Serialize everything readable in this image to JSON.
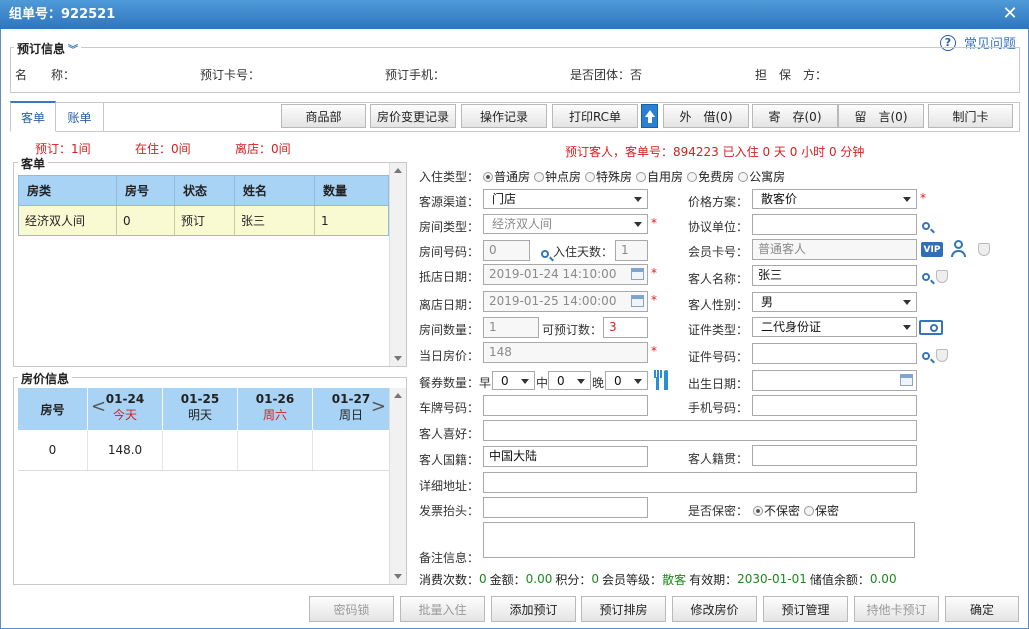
{
  "window": {
    "title": "组单号：922521"
  },
  "help_link": "常见问题",
  "booking_info": {
    "legend": "预订信息",
    "fields": [
      {
        "label": "名　　称：",
        "value": ""
      },
      {
        "label": "预订卡号：",
        "value": ""
      },
      {
        "label": "预订手机：",
        "value": ""
      },
      {
        "label": "是否团体：否",
        "value": ""
      },
      {
        "label": "担　保　方：",
        "value": ""
      }
    ]
  },
  "tabs": [
    "客单",
    "账单"
  ],
  "toolbar": {
    "buttons": [
      "商品部",
      "房价变更记录",
      "操作记录",
      "打印RC单"
    ],
    "buttons2": [
      "外　借(0)",
      "寄　存(0)",
      "留　言(0)",
      "制门卡"
    ]
  },
  "counts": {
    "booked": "预订：1间",
    "in_house": "在住：0间",
    "checked_out": "离店：0间"
  },
  "guest_status": "预订客人，客单号：894223 已入住 0 天 0 小时 0 分钟",
  "guest_list": {
    "legend": "客单",
    "headers": [
      "房类",
      "房号",
      "状态",
      "姓名",
      "数量"
    ],
    "rows": [
      [
        "经济双人间",
        "0",
        "预订",
        "张三",
        "1"
      ]
    ]
  },
  "rate_info": {
    "legend": "房价信息",
    "room_header": "房号",
    "days": [
      {
        "date": "01-24",
        "sub": "今天"
      },
      {
        "date": "01-25",
        "sub": "明天"
      },
      {
        "date": "01-26",
        "sub": "周六"
      },
      {
        "date": "01-27",
        "sub": "周日"
      }
    ],
    "rows": [
      {
        "room": "0",
        "prices": [
          "148.0",
          "",
          "",
          ""
        ]
      }
    ]
  },
  "form": {
    "stay_type": {
      "label": "入住类型：",
      "options": [
        "普通房",
        "钟点房",
        "特殊房",
        "自用房",
        "免费房",
        "公寓房"
      ]
    },
    "source": {
      "label": "客源渠道：",
      "value": "门店"
    },
    "price_plan": {
      "label": "价格方案：",
      "value": "散客价"
    },
    "room_type": {
      "label": "房间类型：",
      "value": "经济双人间"
    },
    "agreement_unit": {
      "label": "协议单位：",
      "value": ""
    },
    "room_no": {
      "label": "房间号码：",
      "value": "0"
    },
    "days_label": "入住天数：",
    "days_value": "1",
    "member_card": {
      "label": "会员卡号：",
      "placeholder": "普通客人"
    },
    "arrival": {
      "label": "抵店日期：",
      "value": "2019-01-24 14:10:00"
    },
    "guest_name": {
      "label": "客人名称：",
      "value": "张三"
    },
    "departure": {
      "label": "离店日期：",
      "value": "2019-01-25 14:00:00"
    },
    "gender": {
      "label": "客人性别：",
      "value": "男"
    },
    "room_count": {
      "label": "房间数量：",
      "value": "1"
    },
    "bookable_label": "可预订数：",
    "bookable_value": "3",
    "id_type": {
      "label": "证件类型：",
      "value": "二代身份证"
    },
    "day_rate": {
      "label": "当日房价：",
      "value": "148"
    },
    "id_no": {
      "label": "证件号码：",
      "value": ""
    },
    "meals": {
      "label": "餐券数量：",
      "breakfast": "早",
      "lunch": "中",
      "dinner": "晚",
      "b": "0",
      "l": "0",
      "d": "0"
    },
    "birth": {
      "label": "出生日期：",
      "value": ""
    },
    "plate": {
      "label": "车牌号码：",
      "value": ""
    },
    "phone": {
      "label": "手机号码：",
      "value": ""
    },
    "preference": {
      "label": "客人喜好：",
      "value": ""
    },
    "nationality": {
      "label": "客人国籍：",
      "value": "中国大陆"
    },
    "native_place": {
      "label": "客人籍贯：",
      "value": ""
    },
    "address": {
      "label": "详细地址：",
      "value": ""
    },
    "invoice": {
      "label": "发票抬头：",
      "value": ""
    },
    "secret": {
      "label": "是否保密：",
      "options": [
        "不保密",
        "保密"
      ]
    },
    "remark": {
      "label": "备注信息：",
      "value": ""
    }
  },
  "summary": {
    "t1": "消费次数：",
    "v1": "0",
    "t2": "金额：",
    "v2": "0.00",
    "t3": "积分：",
    "v3": "0",
    "t4": "会员等级：",
    "v4": "散客",
    "t5": "有效期：",
    "v5": "2030-01-01",
    "t6": "储值余额：",
    "v6": "0.00"
  },
  "footer": {
    "buttons": [
      "密码锁",
      "批量入住",
      "添加预订",
      "预订排房",
      "修改房价",
      "预订管理",
      "持他卡预订",
      "确定"
    ]
  },
  "colors": {
    "title_bar": "#2e76bd",
    "header": "#a8d3f5",
    "row": "#fafad2",
    "red": "#d42020",
    "green": "#1a8a1a"
  }
}
